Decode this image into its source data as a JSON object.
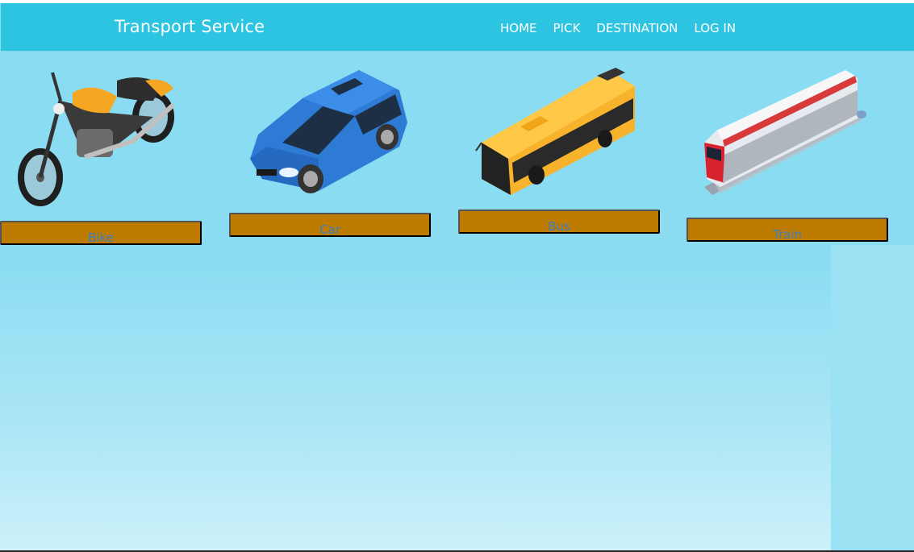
{
  "brand": "Transport Service",
  "nav": [
    "HOME",
    "PICK",
    "DESTINATION",
    "LOG IN"
  ],
  "vehicles": [
    {
      "label": "Bike",
      "icon": "motorcycle-icon"
    },
    {
      "label": "Car",
      "icon": "car-icon"
    },
    {
      "label": "Bus",
      "icon": "bus-icon"
    },
    {
      "label": "Train",
      "icon": "train-icon"
    }
  ],
  "colors": {
    "navbar": "#2cc4e0",
    "background": "#8fdcf0",
    "button": "#bd7b00",
    "button_text": "#3b7fc8"
  }
}
